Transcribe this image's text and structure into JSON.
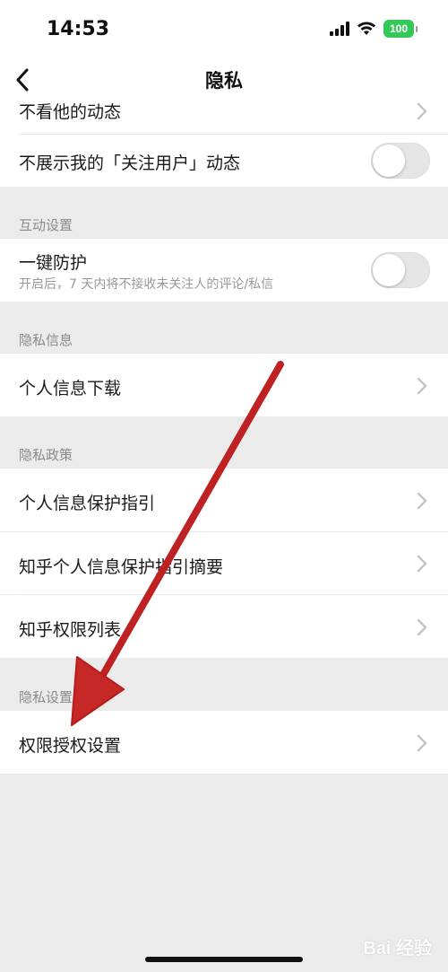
{
  "status_bar": {
    "time": "14:53",
    "battery": "100",
    "icons": [
      "signal-icon",
      "wifi-icon",
      "battery-icon"
    ]
  },
  "nav": {
    "title": "隐私",
    "back_icon": "chevron-left-icon"
  },
  "rows": {
    "hide_dynamic": "不看他的动态",
    "hide_follow": "不展示我的「关注用户」动态",
    "one_key_protect": "一键防护",
    "one_key_protect_sub": "开启后，7 天内将不接收未关注人的评论/私信",
    "personal_download": "个人信息下载",
    "protect_guide": "个人信息保护指引",
    "protect_guide_summary": "知乎个人信息保护指引摘要",
    "permission_list": "知乎权限列表",
    "permission_auth": "权限授权设置"
  },
  "sections": {
    "interaction": "互动设置",
    "privacy_info": "隐私信息",
    "privacy_policy": "隐私政策",
    "privacy_settings": "隐私设置"
  },
  "toggles": {
    "hide_follow_on": false,
    "one_key_protect_on": false
  },
  "watermark": "Bai 经验",
  "colors": {
    "background": "#ebebeb",
    "card": "#ffffff",
    "battery": "#34c759",
    "annotation_arrow": "#d32f2f"
  }
}
